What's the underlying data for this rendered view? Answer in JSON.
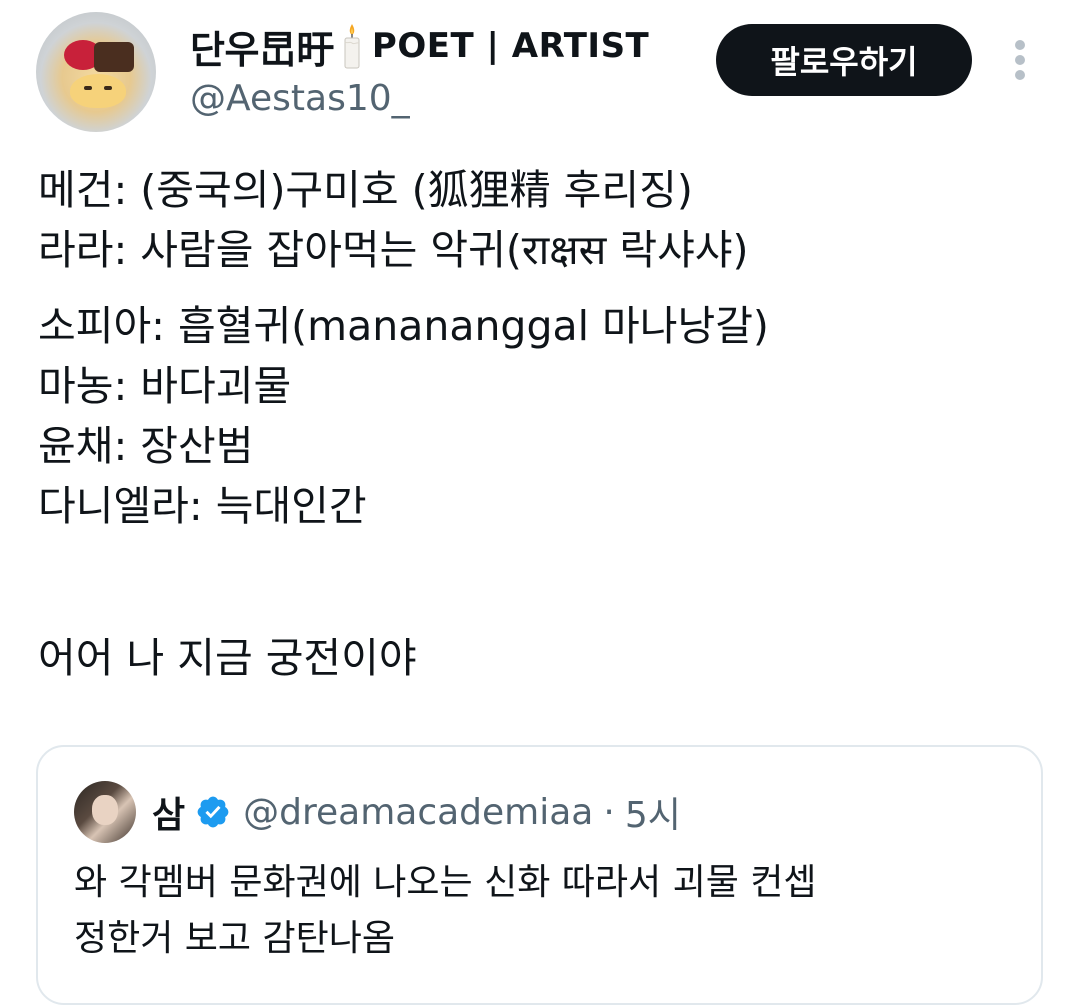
{
  "author": {
    "display_name": "단우旵旴",
    "name_suffix": "POET | ARTIST",
    "handle": "@Aestas10_",
    "name_icon": "candle-icon"
  },
  "actions": {
    "follow_label": "팔로우하기",
    "more_icon": "more-vertical-icon"
  },
  "tweet": {
    "lines": [
      "메건: (중국의)구미호 (狐狸精 후리징)",
      "라라: 사람을 잡아먹는 악귀(राक्षस 락샤샤)",
      "소피아: 흡혈귀(manananggal 마나낭갈)",
      "마농: 바다괴물",
      "윤채: 장산범",
      "다니엘라: 늑대인간"
    ],
    "final_line": "어어 나 지금 궁전이야"
  },
  "quoted_tweet": {
    "name": "삼",
    "verified_icon": "verified-badge-icon",
    "verified_color": "#1d9bf0",
    "handle": "@dreamacademiaa",
    "separator": "·",
    "time": "5시",
    "text_lines": [
      "와 각멤버 문화권에 나오는 신화 따라서 괴물 컨셉",
      "정한거 보고 감탄나옴"
    ]
  }
}
